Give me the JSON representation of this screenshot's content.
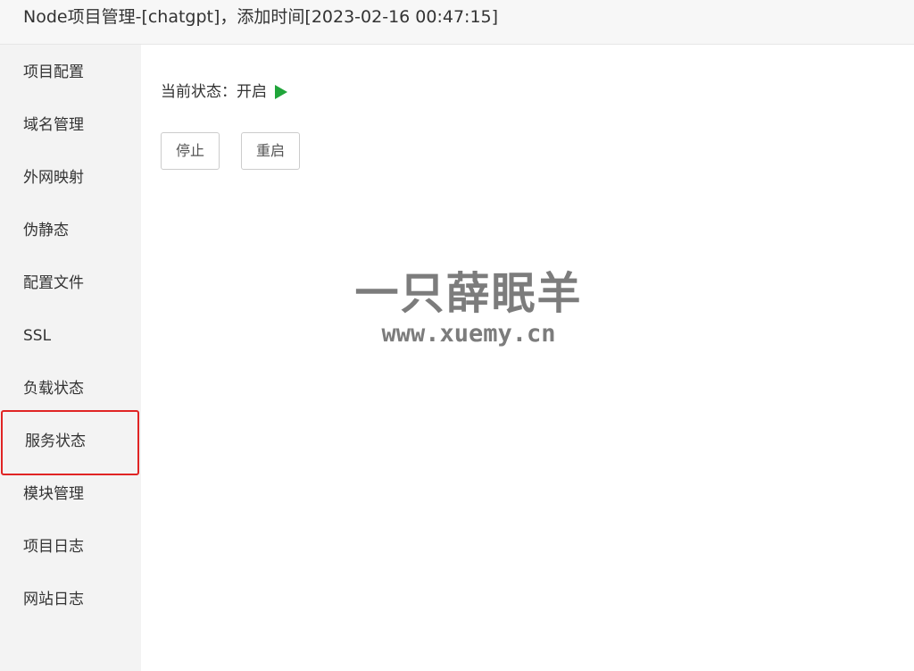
{
  "window": {
    "title": "Node项目管理-[chatgpt]，添加时间[2023-02-16 00:47:15]"
  },
  "sidebar": {
    "items": [
      {
        "label": "项目配置"
      },
      {
        "label": "域名管理"
      },
      {
        "label": "外网映射"
      },
      {
        "label": "伪静态"
      },
      {
        "label": "配置文件"
      },
      {
        "label": "SSL"
      },
      {
        "label": "负载状态"
      },
      {
        "label": "服务状态",
        "highlighted": true
      },
      {
        "label": "模块管理"
      },
      {
        "label": "项目日志"
      },
      {
        "label": "网站日志"
      }
    ]
  },
  "main": {
    "status_label": "当前状态：",
    "status_value": "开启",
    "status_icon": "play-icon",
    "status_color": "#20a53a",
    "stop_label": "停止",
    "restart_label": "重启"
  },
  "watermark": {
    "name": "一只薛眠羊",
    "url": "www.xuemy.cn"
  },
  "colors": {
    "highlight_border": "#e02424",
    "sidebar_bg": "#f3f3f3"
  }
}
